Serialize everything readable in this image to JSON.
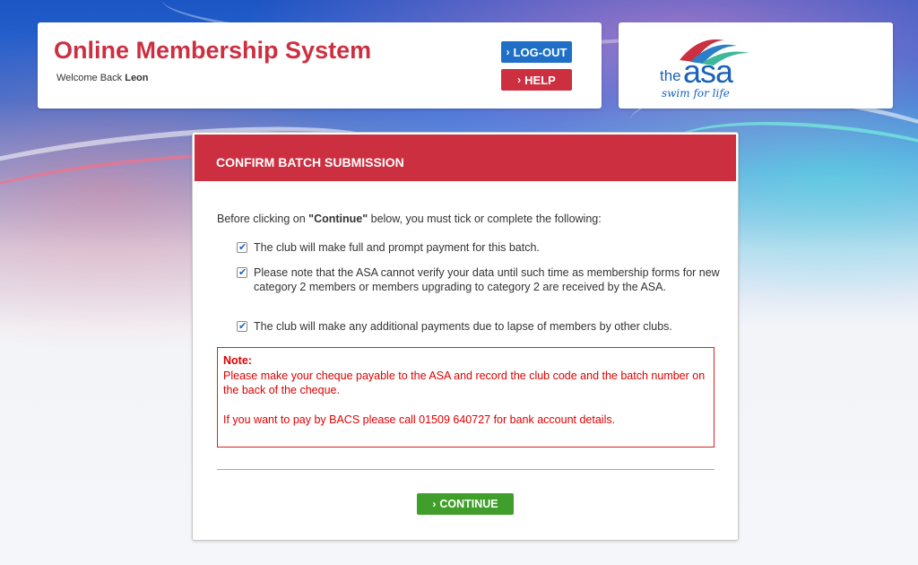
{
  "header": {
    "app_title": "Online Membership System",
    "welcome_prefix": "Welcome Back",
    "user_name": "Leon",
    "logout_label": "LOG-OUT",
    "help_label": "HELP"
  },
  "logo": {
    "the": "the",
    "asa": "asa",
    "tagline": "swim for life"
  },
  "panel": {
    "title": "CONFIRM BATCH SUBMISSION",
    "intro_before": "Before clicking on ",
    "intro_bold": "\"Continue\"",
    "intro_after": " below, you must tick or complete the following:",
    "checks": [
      {
        "label": "The club will make full and prompt payment for this batch.",
        "checked": true
      },
      {
        "label": "Please note that the ASA cannot verify your data until such time as membership forms for new category 2 members or members upgrading to category 2 are received by the ASA.",
        "checked": true
      },
      {
        "label": "The club will make any additional payments due to lapse of members by other clubs.",
        "checked": true
      }
    ],
    "note": {
      "label": "Note:",
      "line1": "Please make your cheque payable to the ASA and record the club code and the batch number on the back of the cheque.",
      "line2": "If you want to pay by BACS please call 01509 640727 for bank account details."
    },
    "continue_label": "CONTINUE"
  },
  "colors": {
    "brand_red": "#cc2f40",
    "logout_blue": "#1e6fc5",
    "continue_green": "#3f9f2a",
    "note_red": "#e00000"
  }
}
